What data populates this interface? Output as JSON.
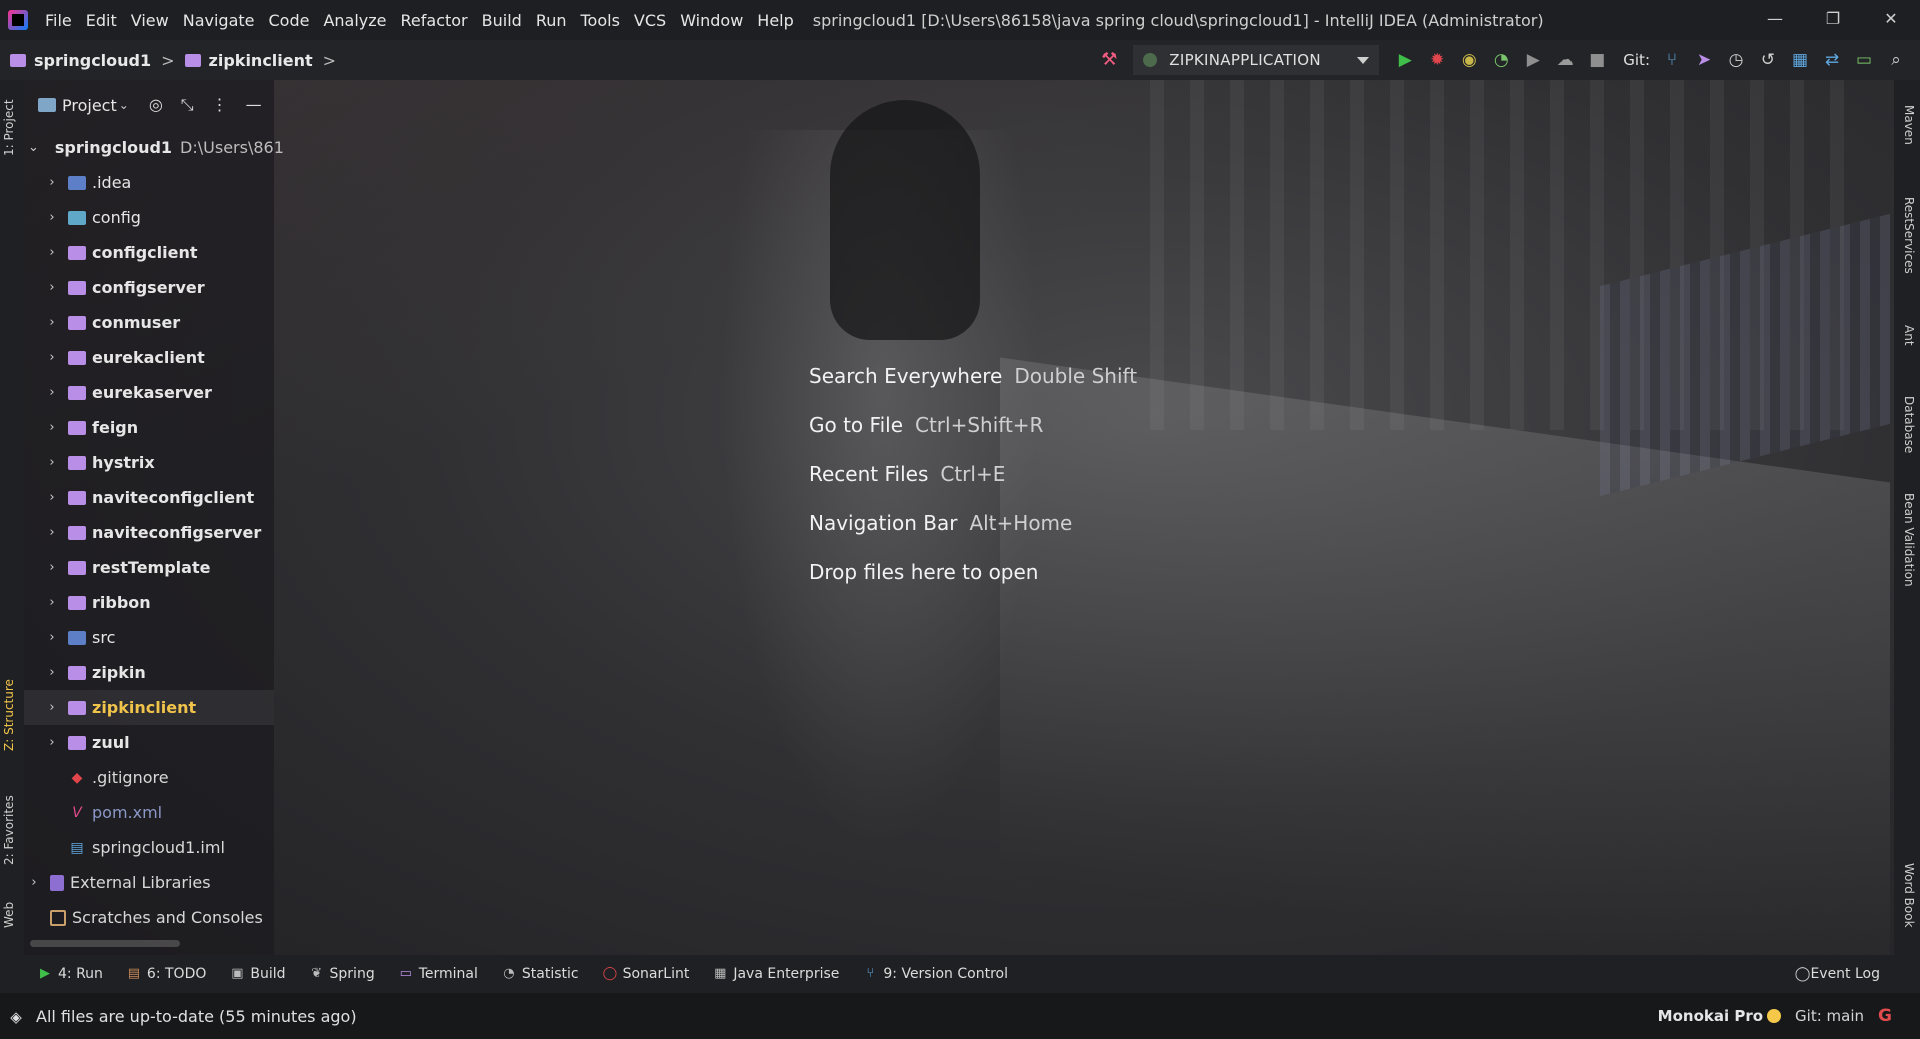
{
  "titlebar": {
    "menu": [
      {
        "label": "File"
      },
      {
        "label": "Edit"
      },
      {
        "label": "View"
      },
      {
        "label": "Navigate"
      },
      {
        "label": "Code"
      },
      {
        "label": "Analyze"
      },
      {
        "label": "Refactor"
      },
      {
        "label": "Build"
      },
      {
        "label": "Run"
      },
      {
        "label": "Tools"
      },
      {
        "label": "VCS"
      },
      {
        "label": "Window"
      },
      {
        "label": "Help"
      }
    ],
    "window_title": "springcloud1 [D:\\Users\\86158\\java spring cloud\\springcloud1] - IntelliJ IDEA (Administrator)",
    "controls": {
      "minimize": "—",
      "restore": "❐",
      "close": "✕"
    }
  },
  "navbar": {
    "breadcrumbs": [
      {
        "label": "springcloud1"
      },
      {
        "label": "zipkinclient"
      }
    ],
    "separator": ">",
    "run_config": "ZIPKINAPPLICATION",
    "git_label": "Git:"
  },
  "left_tabs": {
    "project": "1: Project",
    "structure": "Z: Structure",
    "favorites": "2: Favorites",
    "web": "Web"
  },
  "right_tabs": {
    "maven": "Maven",
    "rest": "RestServices",
    "ant": "Ant",
    "database": "Database",
    "bean": "Bean Validation",
    "wordbook": "Word Book"
  },
  "project_panel": {
    "title": "Project",
    "tree": {
      "root": {
        "name": "springcloud1",
        "path": "D:\\Users\\861"
      },
      "folders": [
        {
          "name": ".idea"
        },
        {
          "name": "config"
        },
        {
          "name": "configclient"
        },
        {
          "name": "configserver"
        },
        {
          "name": "conmuser"
        },
        {
          "name": "eurekaclient"
        },
        {
          "name": "eurekaserver"
        },
        {
          "name": "feign"
        },
        {
          "name": "hystrix"
        },
        {
          "name": "naviteconfigclient"
        },
        {
          "name": "naviteconfigserver"
        },
        {
          "name": "restTemplate"
        },
        {
          "name": "ribbon"
        },
        {
          "name": "src"
        },
        {
          "name": "zipkin"
        },
        {
          "name": "zipkinclient"
        },
        {
          "name": "zuul"
        }
      ],
      "files": [
        {
          "name": ".gitignore"
        },
        {
          "name": "pom.xml"
        },
        {
          "name": "springcloud1.iml"
        }
      ],
      "external": "External Libraries",
      "scratches": "Scratches and Consoles"
    }
  },
  "editor": {
    "hints": [
      {
        "action": "Search Everywhere",
        "keys": "Double Shift"
      },
      {
        "action": "Go to File",
        "keys": "Ctrl+Shift+R"
      },
      {
        "action": "Recent Files",
        "keys": "Ctrl+E"
      },
      {
        "action": "Navigation Bar",
        "keys": "Alt+Home"
      },
      {
        "action": "Drop files here to open",
        "keys": ""
      }
    ]
  },
  "bottom_tabs": [
    {
      "label": "4: Run"
    },
    {
      "label": "6: TODO"
    },
    {
      "label": "Build"
    },
    {
      "label": "Spring"
    },
    {
      "label": "Terminal"
    },
    {
      "label": "Statistic"
    },
    {
      "label": "SonarLint"
    },
    {
      "label": "Java Enterprise"
    },
    {
      "label": "9: Version Control"
    }
  ],
  "event_log": "Event Log",
  "status": {
    "message": "All files are up-to-date (55 minutes ago)",
    "theme": "Monokai Pro",
    "git": "Git: main"
  },
  "colors": {
    "accent_folder": "#b98ee6",
    "selected_text": "#f0c34a",
    "run_green": "#3fbf4a",
    "debug_red": "#e0464c"
  }
}
